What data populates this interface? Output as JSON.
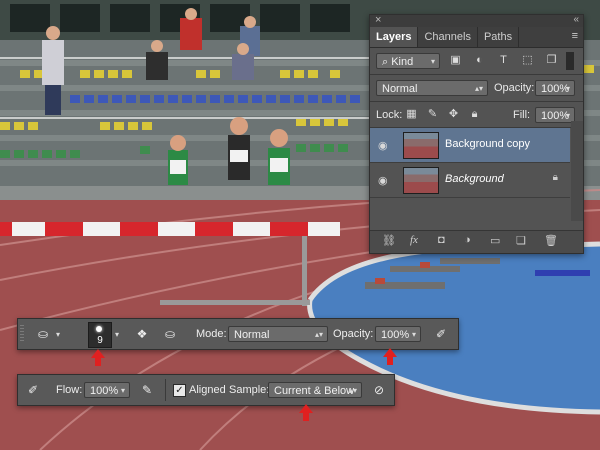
{
  "layers_panel": {
    "tabs": [
      "Layers",
      "Channels",
      "Paths"
    ],
    "kind_filter": "Kind",
    "blend_mode": "Normal",
    "opacity_label": "Opacity:",
    "opacity_value": "100%",
    "lock_label": "Lock:",
    "fill_label": "Fill:",
    "fill_value": "100%",
    "layers": [
      {
        "name": "Background copy",
        "active": true
      },
      {
        "name": "Background",
        "italic": true,
        "locked": true
      }
    ],
    "bottom_icons": [
      "link-icon",
      "fx-icon",
      "mask-icon",
      "adjustment-icon",
      "folder-icon",
      "new-layer-icon",
      "trash-icon"
    ]
  },
  "clone_options": {
    "brush_size": "9",
    "mode_label": "Mode:",
    "mode_value": "Normal",
    "opacity_label": "Opacity:",
    "opacity_value": "100%"
  },
  "clone_options_2": {
    "flow_label": "Flow:",
    "flow_value": "100%",
    "aligned_label": "Aligned",
    "sample_label": "Sample:",
    "sample_value": "Current & Below",
    "aligned_checked": true
  },
  "colors": {
    "panel_bg": "#535353",
    "active_layer": "#5f7591",
    "annotation_red": "#e02020"
  }
}
